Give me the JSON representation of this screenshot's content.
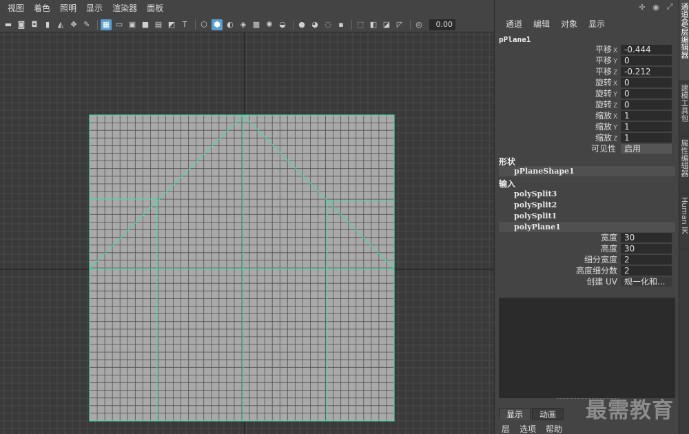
{
  "viewport": {
    "menu": [
      "视图",
      "着色",
      "照明",
      "显示",
      "渲染器",
      "面板"
    ],
    "toolbar_icons": [
      "camera-select-icon",
      "camera-attr-icon",
      "camera-book-icon",
      "bookmark-icon",
      "image-plane-icon",
      "2d-pan-icon",
      "grease-pencil-icon",
      "grid-icon",
      "film-gate-icon",
      "resolution-gate-icon",
      "gate-mask-icon",
      "field-chart-icon",
      "safe-action-icon",
      "safe-title-icon",
      "wireframe-icon",
      "smooth-shade-icon",
      "default-material-icon",
      "wireframe-on-shaded-icon",
      "textured-icon",
      "use-all-lights-icon",
      "shadows-icon",
      "screen-space-ao-icon",
      "motion-blur-icon",
      "multisample-aa-icon",
      "depth-of-field-icon",
      "isolate-select-icon",
      "xray-icon",
      "xray-active-icon",
      "xray-joints-icon",
      "exposure-icon"
    ],
    "exposure_value": "0.00"
  },
  "channel_box": {
    "menu": [
      "通道",
      "编辑",
      "对象",
      "显示"
    ],
    "object_name": "pPlane1",
    "transform_attrs": [
      {
        "label": "平移",
        "axis": "X",
        "value": "-0.444"
      },
      {
        "label": "平移",
        "axis": "Y",
        "value": "0"
      },
      {
        "label": "平移",
        "axis": "Z",
        "value": "-0.212"
      },
      {
        "label": "旋转",
        "axis": "X",
        "value": "0"
      },
      {
        "label": "旋转",
        "axis": "Y",
        "value": "0"
      },
      {
        "label": "旋转",
        "axis": "Z",
        "value": "0"
      },
      {
        "label": "缩放",
        "axis": "X",
        "value": "1"
      },
      {
        "label": "缩放",
        "axis": "Y",
        "value": "1"
      },
      {
        "label": "缩放",
        "axis": "Z",
        "value": "1"
      },
      {
        "label": "可见性",
        "axis": "",
        "value": "启用"
      }
    ],
    "shapes_header": "形状",
    "shape_node": "pPlaneShape1",
    "inputs_header": "输入",
    "input_nodes": [
      "polySplit3",
      "polySplit2",
      "polySplit1",
      "polyPlane1"
    ],
    "input_attrs": [
      {
        "label": "宽度",
        "value": "30"
      },
      {
        "label": "高度",
        "value": "30"
      },
      {
        "label": "细分宽度",
        "value": "2"
      },
      {
        "label": "高度细分数",
        "value": "2"
      },
      {
        "label": "创建 UV",
        "value": "规一化和..."
      }
    ]
  },
  "layer_editor": {
    "tabs": [
      "显示",
      "动画"
    ],
    "menu": [
      "层",
      "选项",
      "帮助"
    ]
  },
  "side_tabs": [
    "通道盒/层编辑器",
    "建模工具包",
    "属性编辑器",
    "Human IK"
  ],
  "top_icons": [
    "workspace-icon",
    "user-icon",
    "expand-icon"
  ],
  "watermark": "最需教育",
  "colors": {
    "wire": "#4fd5a5",
    "plane_fill": "#a9a9a9",
    "grid_line": "#4a4a4a",
    "selection": "#5a9fd1"
  }
}
